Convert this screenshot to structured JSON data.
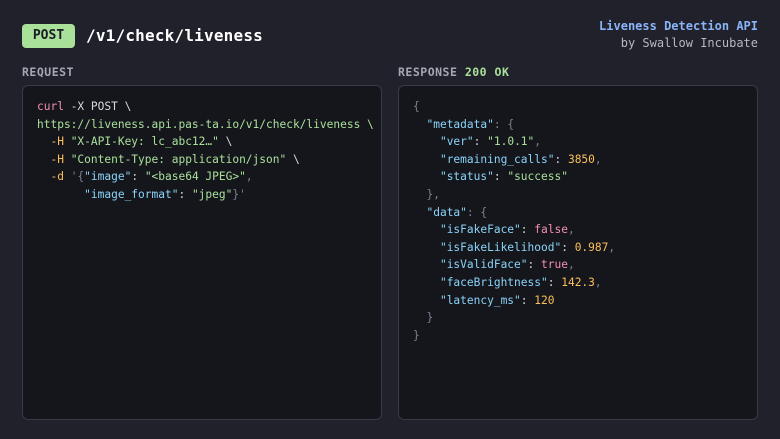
{
  "header": {
    "method": "POST",
    "endpoint": "/v1/check/liveness",
    "brand_title": "Liveness Detection API",
    "brand_sub": "by Swallow Incubate"
  },
  "request": {
    "label": "REQUEST",
    "lines": [
      [
        {
          "t": "curl",
          "c": "kw"
        },
        {
          "t": " -X POST \\",
          "c": "plain"
        }
      ],
      [
        {
          "t": "https://liveness.api.pas-ta.io/v1/check/liveness \\",
          "c": "str"
        }
      ],
      [
        {
          "t": "  -H ",
          "c": "flag"
        },
        {
          "t": "\"X-API-Key: lc_abc12…\"",
          "c": "str"
        },
        {
          "t": " \\",
          "c": "plain"
        }
      ],
      [
        {
          "t": "  -H ",
          "c": "flag"
        },
        {
          "t": "\"Content-Type: application/json\"",
          "c": "str"
        },
        {
          "t": " \\",
          "c": "plain"
        }
      ],
      [
        {
          "t": "  -d ",
          "c": "flag"
        },
        {
          "t": "'{",
          "c": "punc"
        },
        {
          "t": "\"image\"",
          "c": "key"
        },
        {
          "t": ": ",
          "c": "plain"
        },
        {
          "t": "\"<base64 JPEG>\"",
          "c": "str"
        },
        {
          "t": ",",
          "c": "punc"
        }
      ],
      [
        {
          "t": "       ",
          "c": "plain"
        },
        {
          "t": "\"image_format\"",
          "c": "key"
        },
        {
          "t": ": ",
          "c": "plain"
        },
        {
          "t": "\"jpeg\"",
          "c": "str"
        },
        {
          "t": "}'",
          "c": "punc"
        }
      ]
    ]
  },
  "response": {
    "label": "RESPONSE",
    "status": "200 OK",
    "lines": [
      [
        {
          "t": "{",
          "c": "punc"
        }
      ],
      [
        {
          "t": "  ",
          "c": "plain"
        },
        {
          "t": "\"metadata\"",
          "c": "key"
        },
        {
          "t": ": {",
          "c": "punc"
        }
      ],
      [
        {
          "t": "    ",
          "c": "plain"
        },
        {
          "t": "\"ver\"",
          "c": "key"
        },
        {
          "t": ": ",
          "c": "plain"
        },
        {
          "t": "\"1.0.1\"",
          "c": "str"
        },
        {
          "t": ",",
          "c": "punc"
        }
      ],
      [
        {
          "t": "    ",
          "c": "plain"
        },
        {
          "t": "\"remaining_calls\"",
          "c": "key"
        },
        {
          "t": ": ",
          "c": "plain"
        },
        {
          "t": "3850",
          "c": "num"
        },
        {
          "t": ",",
          "c": "punc"
        }
      ],
      [
        {
          "t": "    ",
          "c": "plain"
        },
        {
          "t": "\"status\"",
          "c": "key"
        },
        {
          "t": ": ",
          "c": "plain"
        },
        {
          "t": "\"success\"",
          "c": "str"
        }
      ],
      [
        {
          "t": "  },",
          "c": "punc"
        }
      ],
      [
        {
          "t": "  ",
          "c": "plain"
        },
        {
          "t": "\"data\"",
          "c": "key"
        },
        {
          "t": ": {",
          "c": "punc"
        }
      ],
      [
        {
          "t": "    ",
          "c": "plain"
        },
        {
          "t": "\"isFakeFace\"",
          "c": "key"
        },
        {
          "t": ": ",
          "c": "plain"
        },
        {
          "t": "false",
          "c": "bool"
        },
        {
          "t": ",",
          "c": "punc"
        }
      ],
      [
        {
          "t": "    ",
          "c": "plain"
        },
        {
          "t": "\"isFakeLikelihood\"",
          "c": "key"
        },
        {
          "t": ": ",
          "c": "plain"
        },
        {
          "t": "0.987",
          "c": "num"
        },
        {
          "t": ",",
          "c": "punc"
        }
      ],
      [
        {
          "t": "    ",
          "c": "plain"
        },
        {
          "t": "\"isValidFace\"",
          "c": "key"
        },
        {
          "t": ": ",
          "c": "plain"
        },
        {
          "t": "true",
          "c": "bool"
        },
        {
          "t": ",",
          "c": "punc"
        }
      ],
      [
        {
          "t": "    ",
          "c": "plain"
        },
        {
          "t": "\"faceBrightness\"",
          "c": "key"
        },
        {
          "t": ": ",
          "c": "plain"
        },
        {
          "t": "142.3",
          "c": "num"
        },
        {
          "t": ",",
          "c": "punc"
        }
      ],
      [
        {
          "t": "    ",
          "c": "plain"
        },
        {
          "t": "\"latency_ms\"",
          "c": "key"
        },
        {
          "t": ": ",
          "c": "plain"
        },
        {
          "t": "120",
          "c": "num"
        }
      ],
      [
        {
          "t": "  }",
          "c": "punc"
        }
      ],
      [
        {
          "t": "}",
          "c": "punc"
        }
      ]
    ]
  },
  "colors": {
    "background": "#20212b",
    "panel": "#15161c",
    "accent_green": "#a9e09a",
    "accent_blue": "#8ab4f8",
    "keyword_pink": "#f48fb1",
    "number_orange": "#fbbf5b"
  }
}
